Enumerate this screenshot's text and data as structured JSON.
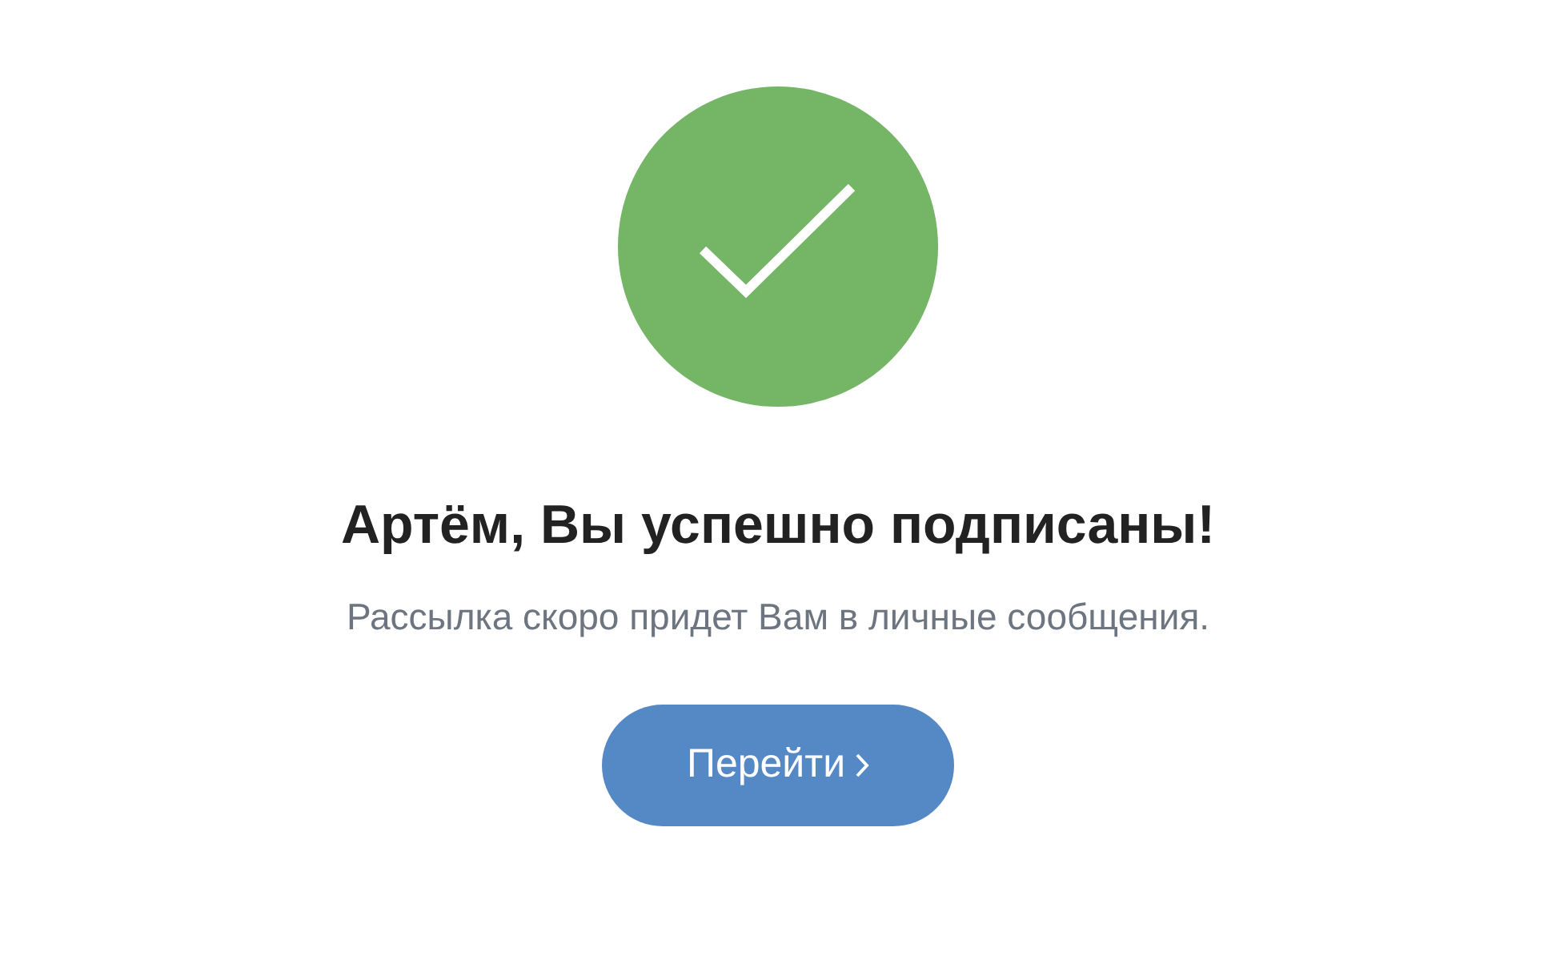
{
  "title": "Артём, Вы успешно подписаны!",
  "subtitle": "Рассылка скоро придет Вам в личные сообщения.",
  "button": {
    "label": "Перейти"
  }
}
